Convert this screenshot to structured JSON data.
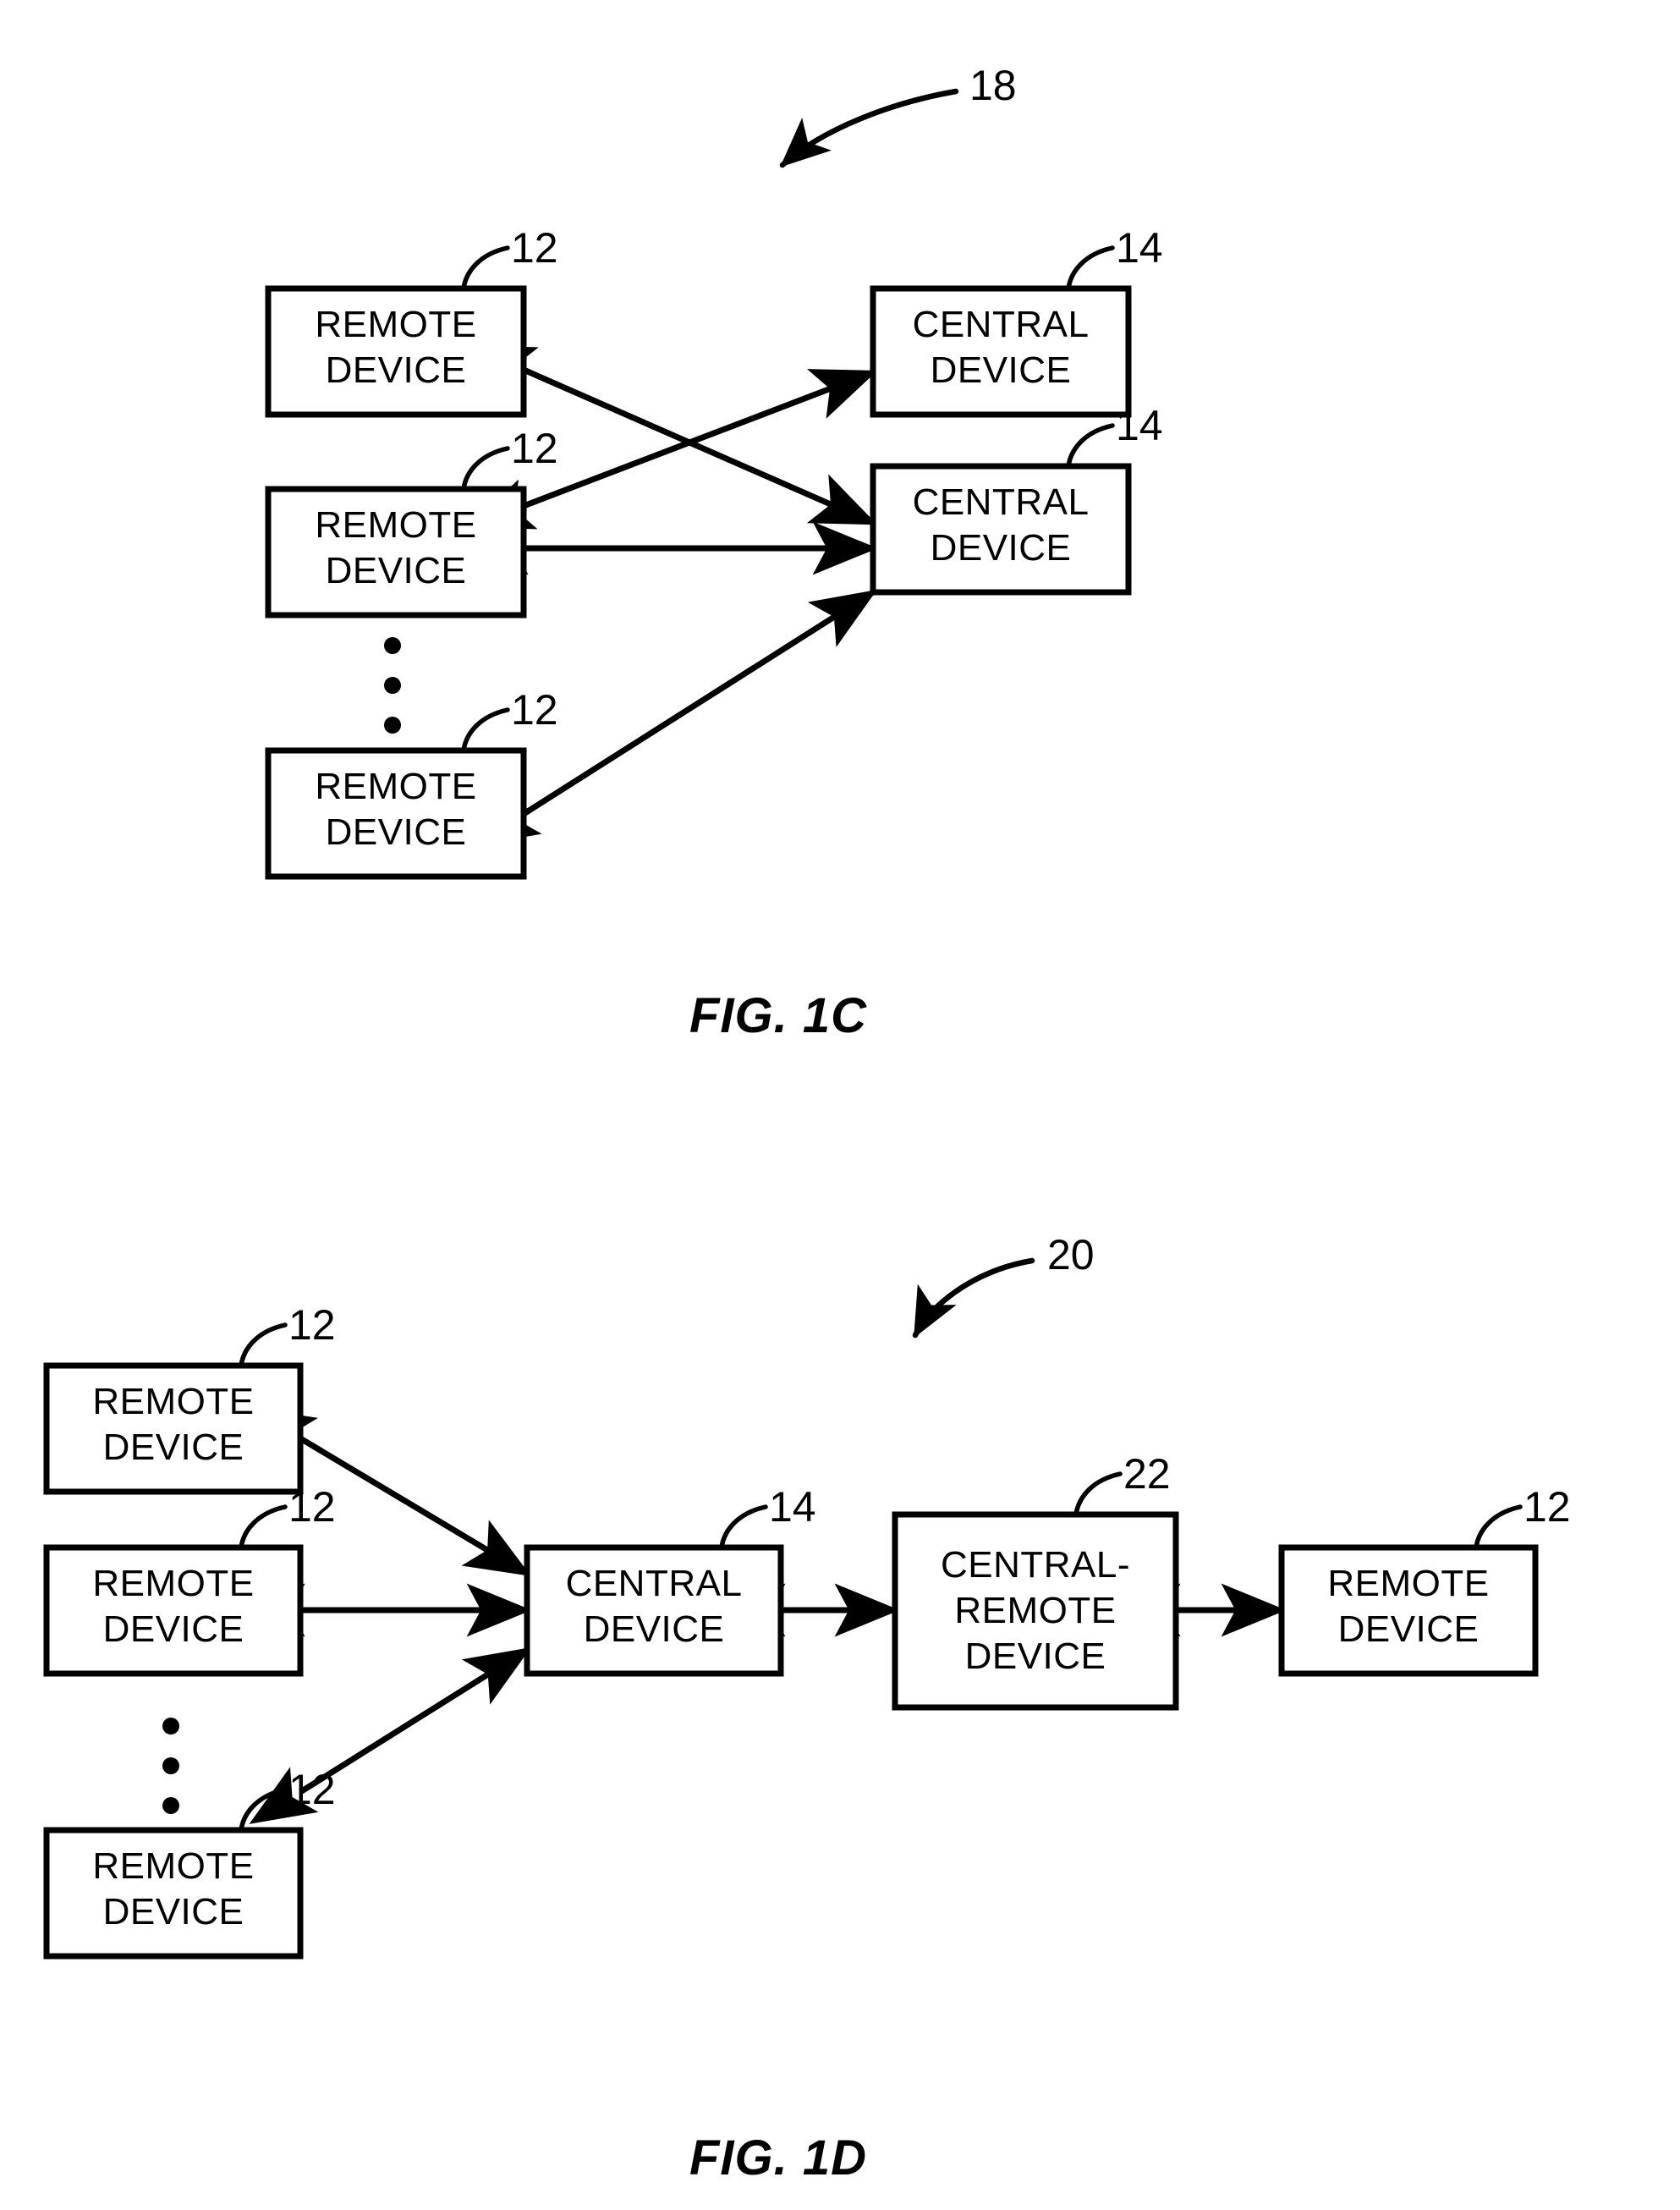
{
  "figures": [
    {
      "id": "fig-1c",
      "caption": "FIG. 1C",
      "system_ref": "18",
      "nodes": [
        {
          "key": "rd1",
          "label_line1": "REMOTE",
          "label_line2": "DEVICE",
          "ref": "12"
        },
        {
          "key": "rd2",
          "label_line1": "REMOTE",
          "label_line2": "DEVICE",
          "ref": "12"
        },
        {
          "key": "rd3",
          "label_line1": "REMOTE",
          "label_line2": "DEVICE",
          "ref": "12"
        },
        {
          "key": "cd1",
          "label_line1": "CENTRAL",
          "label_line2": "DEVICE",
          "ref": "14"
        },
        {
          "key": "cd2",
          "label_line1": "CENTRAL",
          "label_line2": "DEVICE",
          "ref": "14"
        }
      ],
      "ellipsis_dots": 3,
      "links": [
        {
          "from": "rd1",
          "to": "cd2",
          "arrows": "both"
        },
        {
          "from": "rd2",
          "to": "cd1",
          "arrows": "both"
        },
        {
          "from": "rd2",
          "to": "cd2",
          "arrows": "both"
        },
        {
          "from": "rd3",
          "to": "cd2",
          "arrows": "both"
        }
      ]
    },
    {
      "id": "fig-1d",
      "caption": "FIG. 1D",
      "system_ref": "20",
      "nodes": [
        {
          "key": "rd1",
          "label_line1": "REMOTE",
          "label_line2": "DEVICE",
          "label_line3": "",
          "ref": "12"
        },
        {
          "key": "rd2",
          "label_line1": "REMOTE",
          "label_line2": "DEVICE",
          "label_line3": "",
          "ref": "12"
        },
        {
          "key": "rd3",
          "label_line1": "REMOTE",
          "label_line2": "DEVICE",
          "label_line3": "",
          "ref": "12"
        },
        {
          "key": "cd",
          "label_line1": "CENTRAL",
          "label_line2": "DEVICE",
          "label_line3": "",
          "ref": "14"
        },
        {
          "key": "crd",
          "label_line1": "CENTRAL-",
          "label_line2": "REMOTE",
          "label_line3": "DEVICE",
          "ref": "22"
        },
        {
          "key": "rd4",
          "label_line1": "REMOTE",
          "label_line2": "DEVICE",
          "label_line3": "",
          "ref": "12"
        }
      ],
      "ellipsis_dots": 3,
      "links": [
        {
          "from": "rd1",
          "to": "cd",
          "arrows": "both"
        },
        {
          "from": "rd2",
          "to": "cd",
          "arrows": "both"
        },
        {
          "from": "rd3",
          "to": "cd",
          "arrows": "both"
        },
        {
          "from": "cd",
          "to": "crd",
          "arrows": "both"
        },
        {
          "from": "crd",
          "to": "rd4",
          "arrows": "both"
        }
      ]
    }
  ],
  "colors": {
    "ink": "#000000",
    "paper": "#ffffff"
  }
}
